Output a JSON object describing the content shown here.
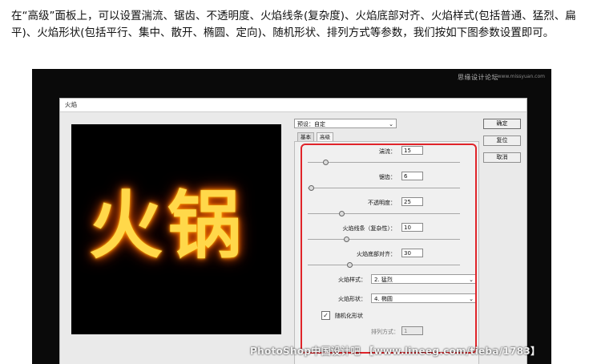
{
  "intro_text": "在“高级”面板上，可以设置湍流、锯齿、不透明度、火焰线条(复杂度)、火焰底部对齐、火焰样式(包括普通、猛烈、扁平)、火焰形状(包括平行、集中、散开、椭圆、定向)、随机形状、排列方式等参数，我们按如下图参数设置即可。",
  "screenshot": {
    "top_watermark": "思缘设计论坛",
    "top_watermark_url": "www.missyuan.com",
    "dialog": {
      "title": "火焰",
      "preview_text": "火锅",
      "preset_label": "预设：自定",
      "tabs": [
        {
          "label": "基本",
          "active": false
        },
        {
          "label": "高级",
          "active": true
        }
      ],
      "params": [
        {
          "label": "湍流：",
          "value": "15"
        },
        {
          "label": "锯齿：",
          "value": "6"
        },
        {
          "label": "不透明度：",
          "value": "25"
        },
        {
          "label": "火焰线条（复杂性）：",
          "value": "10"
        },
        {
          "label": "火焰底部对齐：",
          "value": "30"
        }
      ],
      "flame_style": {
        "label": "火焰样式：",
        "value": "2. 猛烈"
      },
      "flame_shape": {
        "label": "火焰形状：",
        "value": "4. 椭圆"
      },
      "random_shape": {
        "label": "随机化形状",
        "checked": true
      },
      "arrangement": {
        "label": "排列方式：",
        "value": "1"
      },
      "buttons": {
        "ok": "确定",
        "reset": "复位",
        "cancel": "取消"
      }
    },
    "bottom_watermark": "PhotoShop中国设计吧 【www.lineeg.com/tieba/1783】",
    "accent_color": "#e0242a"
  }
}
